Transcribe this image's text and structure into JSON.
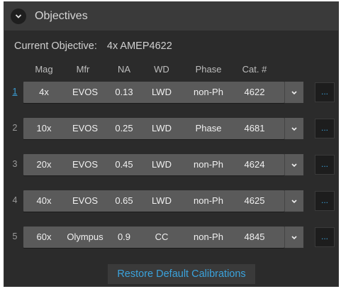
{
  "panel": {
    "title": "Objectives",
    "collapse_icon": "chevron-down-icon"
  },
  "current": {
    "label": "Current Objective:",
    "value": "4x AMEP4622"
  },
  "columns": {
    "mag": "Mag",
    "mfr": "Mfr",
    "na": "NA",
    "wd": "WD",
    "phase": "Phase",
    "cat": "Cat. #"
  },
  "rows": [
    {
      "num": "1",
      "mag": "4x",
      "mfr": "EVOS",
      "na": "0.13",
      "wd": "LWD",
      "phase": "non-Ph",
      "cat": "4622",
      "active": true
    },
    {
      "num": "2",
      "mag": "10x",
      "mfr": "EVOS",
      "na": "0.25",
      "wd": "LWD",
      "phase": "Phase",
      "cat": "4681",
      "active": false
    },
    {
      "num": "3",
      "mag": "20x",
      "mfr": "EVOS",
      "na": "0.45",
      "wd": "LWD",
      "phase": "non-Ph",
      "cat": "4624",
      "active": false
    },
    {
      "num": "4",
      "mag": "40x",
      "mfr": "EVOS",
      "na": "0.65",
      "wd": "LWD",
      "phase": "non-Ph",
      "cat": "4625",
      "active": false
    },
    {
      "num": "5",
      "mag": "60x",
      "mfr": "Olympus",
      "na": "0.9",
      "wd": "CC",
      "phase": "non-Ph",
      "cat": "4845",
      "active": false
    }
  ],
  "more_label": "...",
  "restore_label": "Restore Default Calibrations",
  "colors": {
    "accent": "#3a9fd6",
    "panel_bg": "#2b2b2b",
    "row_bg": "#5a5a5a"
  }
}
